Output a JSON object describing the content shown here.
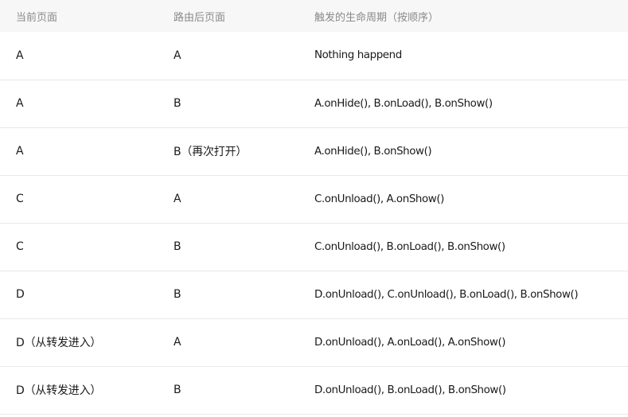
{
  "table": {
    "headers": [
      "当前页面",
      "路由后页面",
      "触发的生命周期（按顺序）"
    ],
    "rows": [
      [
        "A",
        "A",
        "Nothing happend"
      ],
      [
        "A",
        "B",
        "A.onHide(), B.onLoad(), B.onShow()"
      ],
      [
        "A",
        "B（再次打开）",
        "A.onHide(), B.onShow()"
      ],
      [
        "C",
        "A",
        "C.onUnload(), A.onShow()"
      ],
      [
        "C",
        "B",
        "C.onUnload(), B.onLoad(), B.onShow()"
      ],
      [
        "D",
        "B",
        "D.onUnload(), C.onUnload(), B.onLoad(), B.onShow()"
      ],
      [
        "D（从转发进入）",
        "A",
        "D.onUnload(), A.onLoad(), A.onShow()"
      ],
      [
        "D（从转发进入）",
        "B",
        "D.onUnload(), B.onLoad(), B.onShow()"
      ]
    ]
  }
}
